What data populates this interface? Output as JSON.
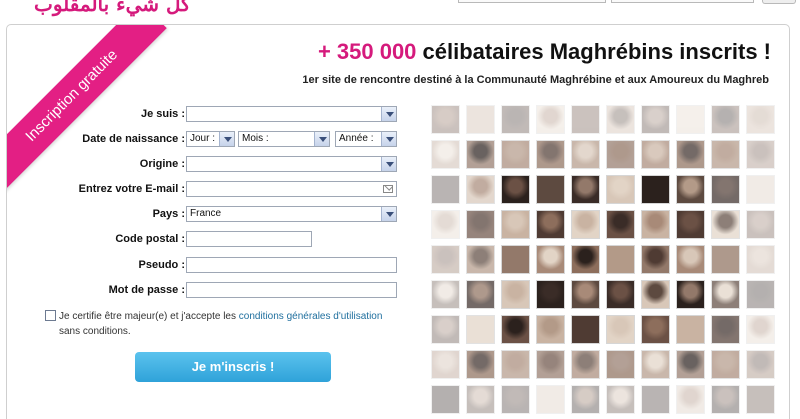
{
  "top": {
    "logo_text": "كل شيء بالمقلوب"
  },
  "ribbon": {
    "label": "Inscription gratuite"
  },
  "headline": {
    "number": "+ 350 000",
    "rest": " célibataires Maghrébins inscrits !"
  },
  "subline": "1er site de rencontre destiné à la Communauté Maghrébine et aux Amoureux du Maghreb",
  "form": {
    "je_suis_label": "Je suis :",
    "je_suis_value": "",
    "dob_label": "Date de naissance :",
    "dob_day": "Jour :",
    "dob_month": "Mois :",
    "dob_year": "Année :",
    "origine_label": "Origine :",
    "origine_value": "",
    "email_label": "Entrez votre E-mail :",
    "email_value": "",
    "pays_label": "Pays :",
    "pays_value": "France",
    "cp_label": "Code postal :",
    "cp_value": "",
    "pseudo_label": "Pseudo :",
    "pseudo_value": "",
    "mdp_label": "Mot de passe :",
    "mdp_value": "",
    "cert_before": "Je certifie être majeur(e) et j'accepte les ",
    "cert_link": "conditions générales d'utilisation",
    "cert_after": " sans conditions.",
    "submit_label": "Je m'inscris !"
  },
  "colors": {
    "accent": "#e31f84",
    "headline_number": "#d51a7c",
    "button": "#3ab0e2",
    "link": "#1f6f9e"
  }
}
